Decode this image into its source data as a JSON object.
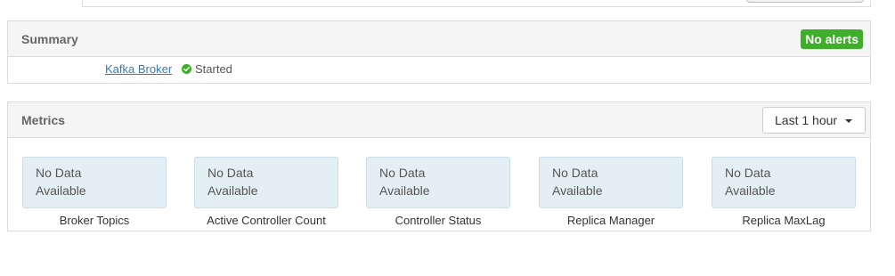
{
  "summary": {
    "title": "Summary",
    "alerts_badge": "No alerts",
    "component": {
      "name": "Kafka Broker",
      "status": "Started",
      "status_icon": "check-circle-icon",
      "status_color": "#3fae2a"
    }
  },
  "metrics": {
    "title": "Metrics",
    "time_range": {
      "label": "Last 1 hour",
      "icon": "caret-down-icon"
    },
    "widgets": [
      {
        "line1": "No Data",
        "line2": "Available",
        "label": "Broker Topics"
      },
      {
        "line1": "No Data",
        "line2": "Available",
        "label": "Active Controller Count"
      },
      {
        "line1": "No Data",
        "line2": "Available",
        "label": "Controller Status"
      },
      {
        "line1": "No Data",
        "line2": "Available",
        "label": "Replica Manager"
      },
      {
        "line1": "No Data",
        "line2": "Available",
        "label": "Replica MaxLag"
      }
    ]
  },
  "colors": {
    "accent_link": "#337ab7",
    "success": "#3fae2a",
    "widget_bg": "#e4eff5"
  }
}
